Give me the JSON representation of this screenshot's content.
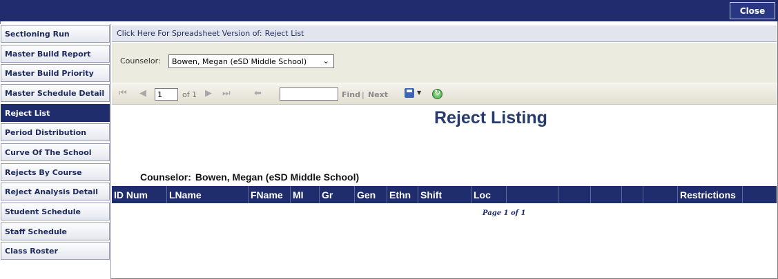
{
  "topbar": {
    "close_label": "Close"
  },
  "sidebar": {
    "items": [
      {
        "label": "Sectioning Run"
      },
      {
        "label": "Master Build Report"
      },
      {
        "label": "Master Build Priority"
      },
      {
        "label": "Master Schedule Detail"
      },
      {
        "label": "Reject List",
        "active": true
      },
      {
        "label": "Period Distribution"
      },
      {
        "label": "Curve Of The School"
      },
      {
        "label": "Rejects By Course"
      },
      {
        "label": "Reject Analysis Detail"
      },
      {
        "label": "Student Schedule"
      },
      {
        "label": "Staff Schedule"
      },
      {
        "label": "Class Roster"
      }
    ]
  },
  "header": {
    "spreadsheet_link": "Click Here For Spreadsheet Version of:",
    "report_name": "Reject List"
  },
  "params": {
    "counselor_label": "Counselor:",
    "counselor_value": "Bowen, Megan  (eSD Middle School)"
  },
  "toolbar": {
    "page_value": "1",
    "of_label": "of 1",
    "find_label": "Find",
    "separator": "|",
    "next_label": "Next",
    "find_value": ""
  },
  "report": {
    "title": "Reject Listing",
    "counselor_label": "Counselor:",
    "counselor_value": "Bowen, Megan  (eSD Middle School)",
    "columns": [
      "ID Num",
      "LName",
      "FName",
      "MI",
      "Gr",
      "Gen",
      "Ethn",
      "Shift",
      "Loc",
      "",
      "",
      "",
      "",
      "",
      "Restrictions"
    ],
    "footer": "Page 1 of 1"
  },
  "colors": {
    "navy": "#1f2d6c",
    "toolbar_bg": "#ecebe0",
    "sidebar_active": "#1f2d6c"
  }
}
